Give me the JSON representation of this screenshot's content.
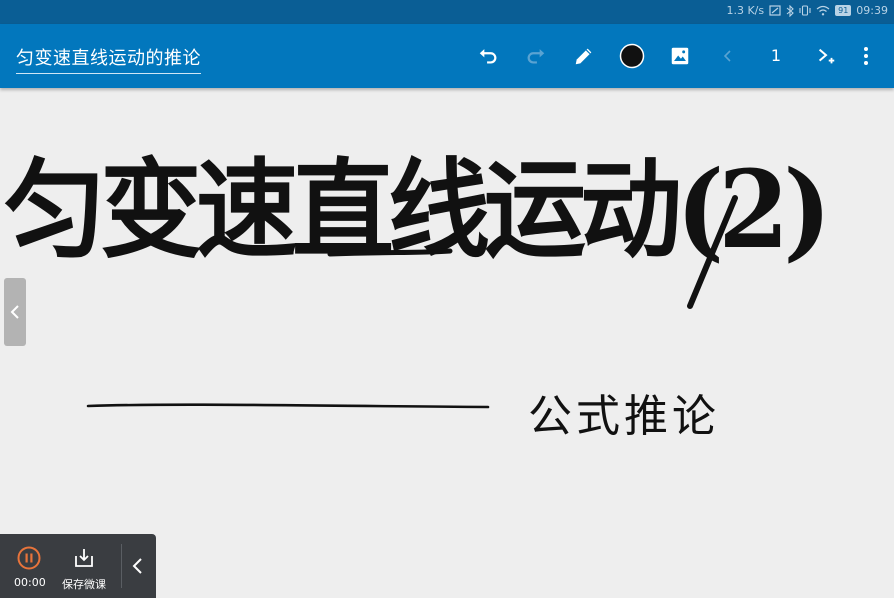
{
  "statusbar": {
    "speed": "1.3 K/s",
    "battery": "91",
    "time": "09:39",
    "icons": [
      "nfc-icon",
      "bluetooth-icon",
      "vibrate-icon",
      "wifi-icon",
      "battery-icon"
    ]
  },
  "toolbar": {
    "title": "匀变速直线运动的推论",
    "page_number": "1",
    "icons": [
      "undo-icon",
      "redo-icon",
      "pencil-icon",
      "color-circle-icon",
      "image-icon",
      "prev-page-icon",
      "add-page-icon",
      "more-icon"
    ],
    "pen_color": "#111111"
  },
  "canvas": {
    "handwriting_title": "匀变速直线运动(2)",
    "handwriting_subtitle": "公式推论"
  },
  "recorder": {
    "elapsed": "00:00",
    "save_label": "保存微课"
  },
  "colors": {
    "toolbar": "#0277bd",
    "statusbar": "#0a5e95",
    "canvas": "#eeeeee",
    "recorder_panel": "#3a3d41",
    "record_accent": "#e8743b"
  }
}
